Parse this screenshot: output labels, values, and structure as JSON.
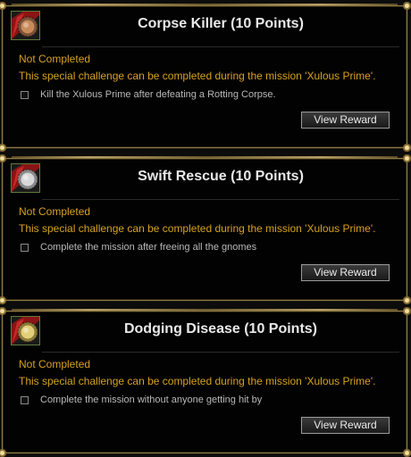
{
  "challenges": [
    {
      "title": "Corpse Killer (10 Points)",
      "medal": "bronze",
      "medal_color": "#c98b5a",
      "status": "Not Completed",
      "description": "This special challenge can be completed during the mission 'Xulous Prime'.",
      "task": "Kill the Xulous Prime after defeating a Rotting Corpse.",
      "button": "View Reward"
    },
    {
      "title": "Swift Rescue (10 Points)",
      "medal": "silver",
      "medal_color": "#d8d8d8",
      "status": "Not Completed",
      "description": "This special challenge can be completed during the mission 'Xulous Prime'.",
      "task": "Complete the mission after freeing all the gnomes",
      "button": "View Reward"
    },
    {
      "title": "Dodging Disease (10 Points)",
      "medal": "gold",
      "medal_color": "#e3cf7a",
      "status": "Not Completed",
      "description": "This special challenge can be completed during the mission 'Xulous Prime'.",
      "task": "Complete the mission without anyone getting hit by",
      "button": "View Reward"
    }
  ],
  "colors": {
    "status_text": "#d7a11e",
    "frame_gold": "#8e7a45",
    "title_text": "#e9e9e9"
  }
}
